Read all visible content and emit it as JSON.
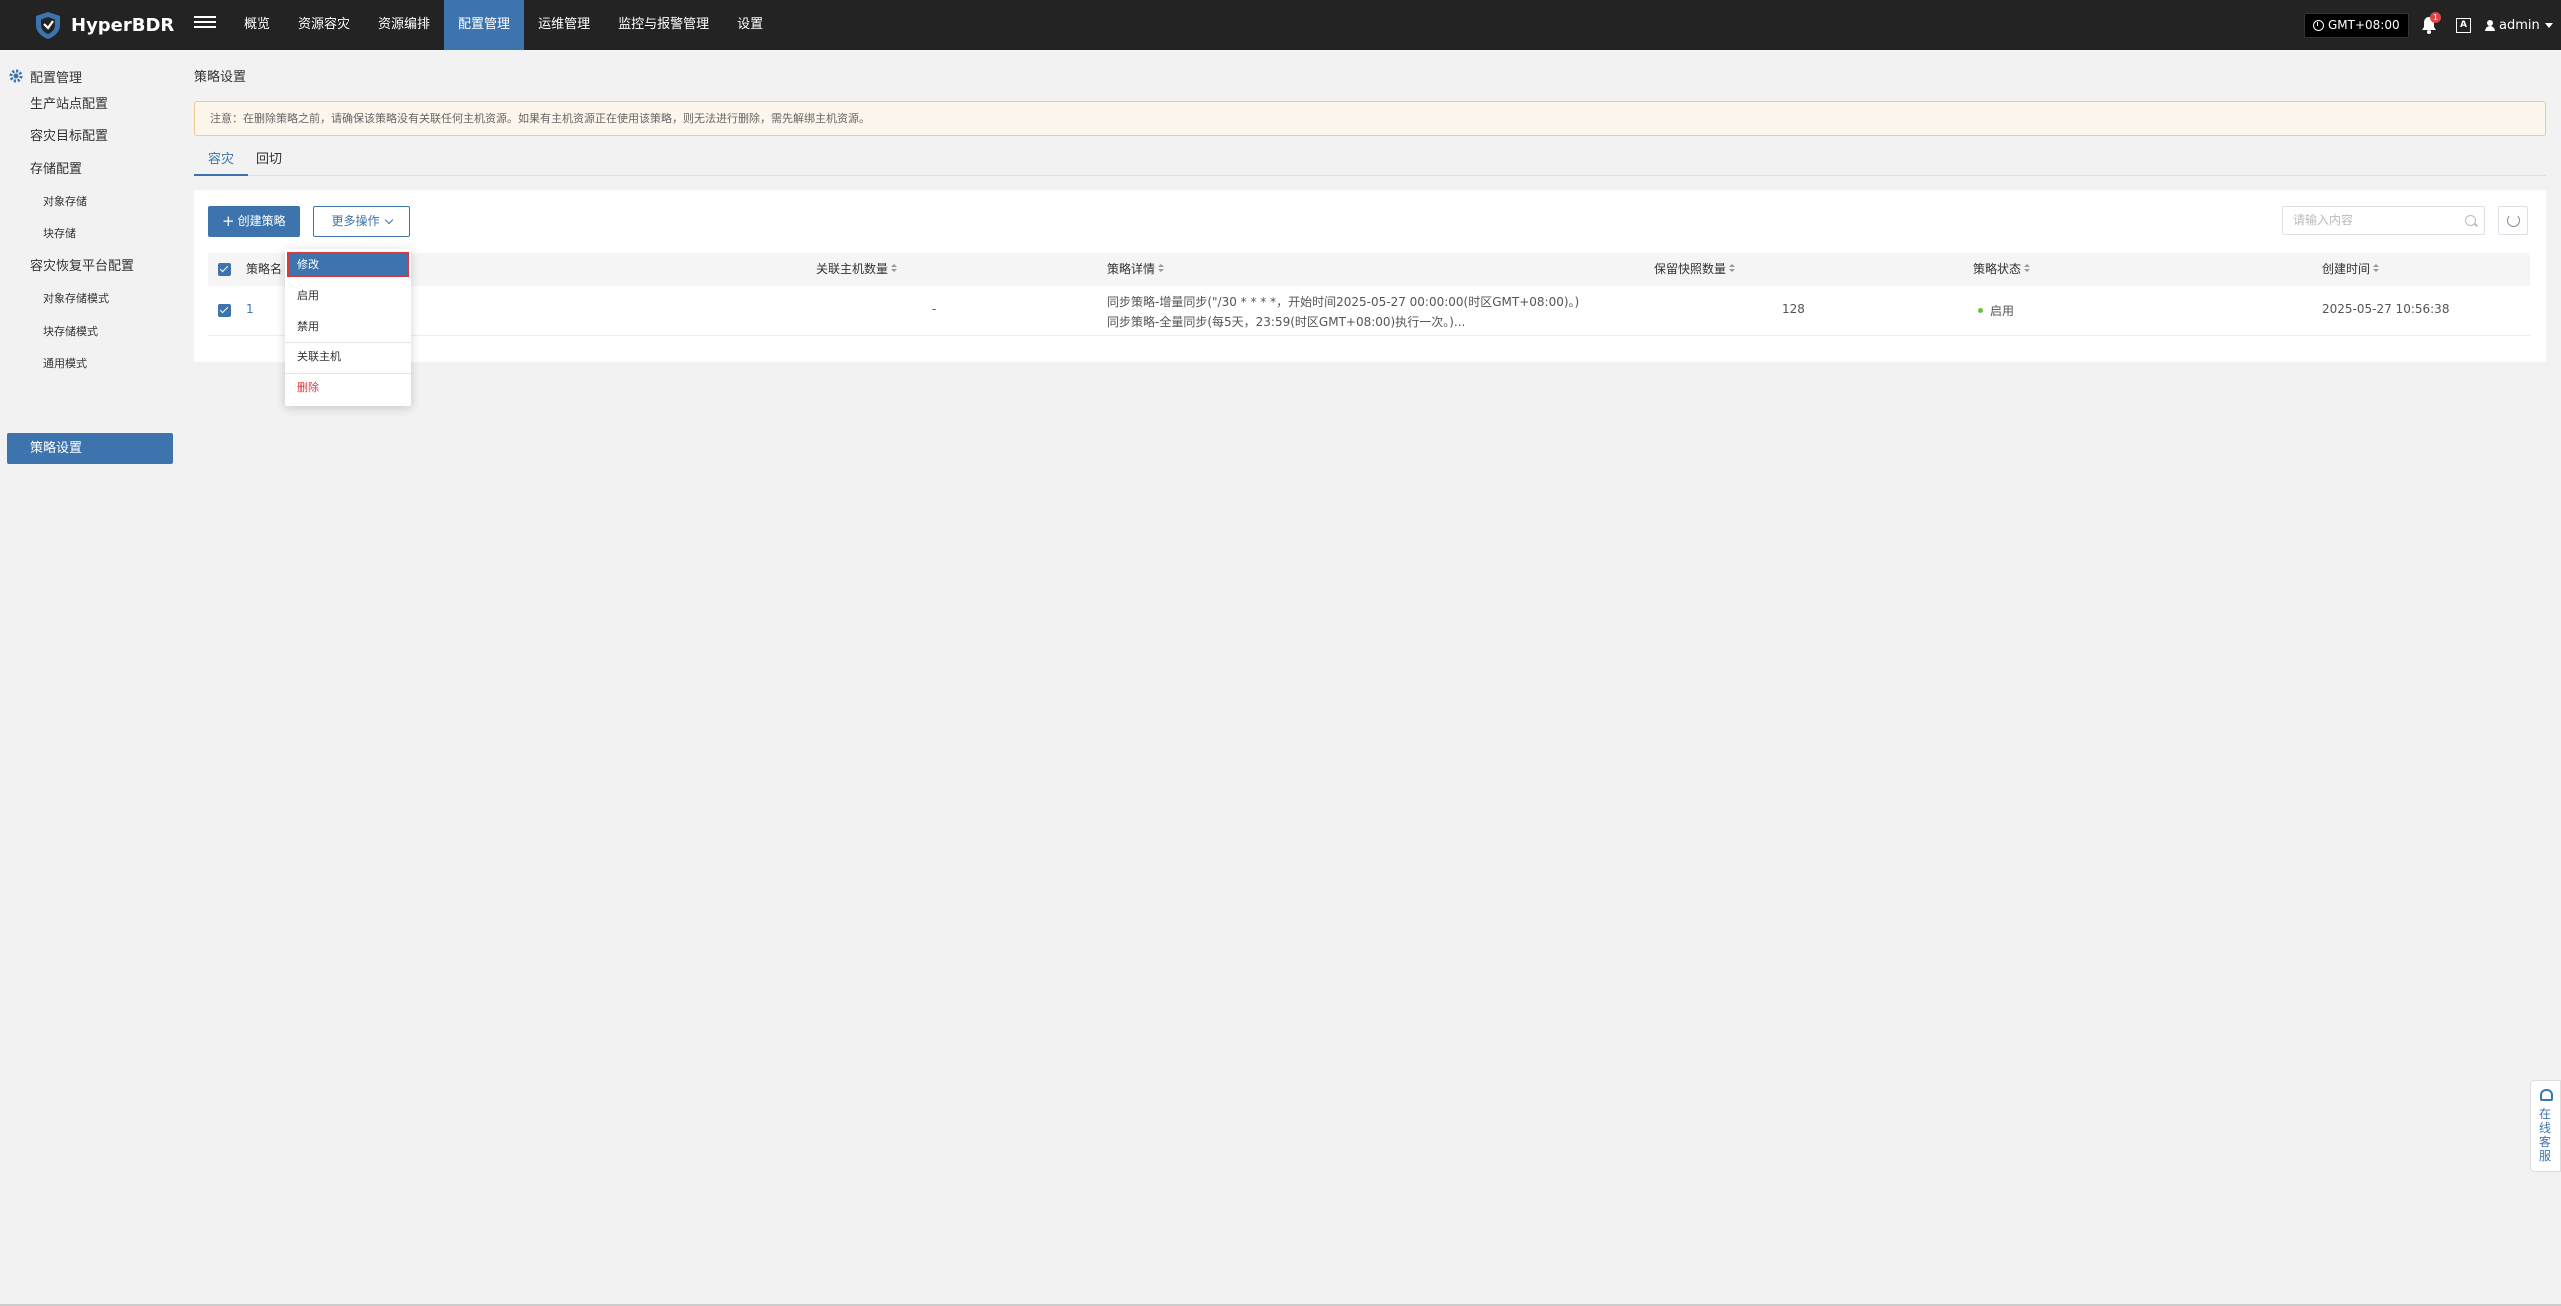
{
  "app": {
    "logo_text": "HyperBDR"
  },
  "nav": {
    "items": [
      "概览",
      "资源容灾",
      "资源编排",
      "配置管理",
      "运维管理",
      "监控与报警管理",
      "设置"
    ],
    "active_index": 3
  },
  "header": {
    "timezone": "GMT+08:00",
    "notification_count": "1",
    "language_icon_label": "A",
    "user": "admin"
  },
  "sidebar": {
    "section": "配置管理",
    "items": [
      "生产站点配置",
      "容灾目标配置",
      "存储配置",
      "对象存储",
      "块存储",
      "容灾恢复平台配置",
      "对象存储模式",
      "块存储模式",
      "通用模式",
      "策略设置"
    ]
  },
  "page": {
    "title": "策略设置",
    "notice": "注意：在删除策略之前，请确保该策略没有关联任何主机资源。如果有主机资源正在使用该策略，则无法进行删除，需先解绑主机资源。",
    "tabs": [
      "容灾",
      "回切"
    ],
    "create_button": "创建策略",
    "more_button": "更多操作",
    "search_placeholder": "请输入内容"
  },
  "table": {
    "columns": [
      "策略名称",
      "关联主机数量",
      "策略详情",
      "保留快照数量",
      "策略状态",
      "创建时间"
    ],
    "header_visible_name": "策略名",
    "rows": [
      {
        "name": "1",
        "host_count": "-",
        "detail_line1": "同步策略-增量同步(\"/30 * * * *，开始时间2025-05-27 00:00:00(时区GMT+08:00)。)",
        "detail_line2": "同步策略-全量同步(每5天，23:59(时区GMT+08:00)执行一次。)...",
        "snapshots": "128",
        "status": "启用",
        "created": "2025-05-27 10:56:38"
      }
    ]
  },
  "dropdown": {
    "items": [
      "修改",
      "启用",
      "禁用",
      "关联主机",
      "删除"
    ]
  },
  "customer_service": "在线客服",
  "colors": {
    "primary": "#3d74ad",
    "topbar": "#232323",
    "danger": "#d9383e",
    "success": "#67c23a"
  }
}
